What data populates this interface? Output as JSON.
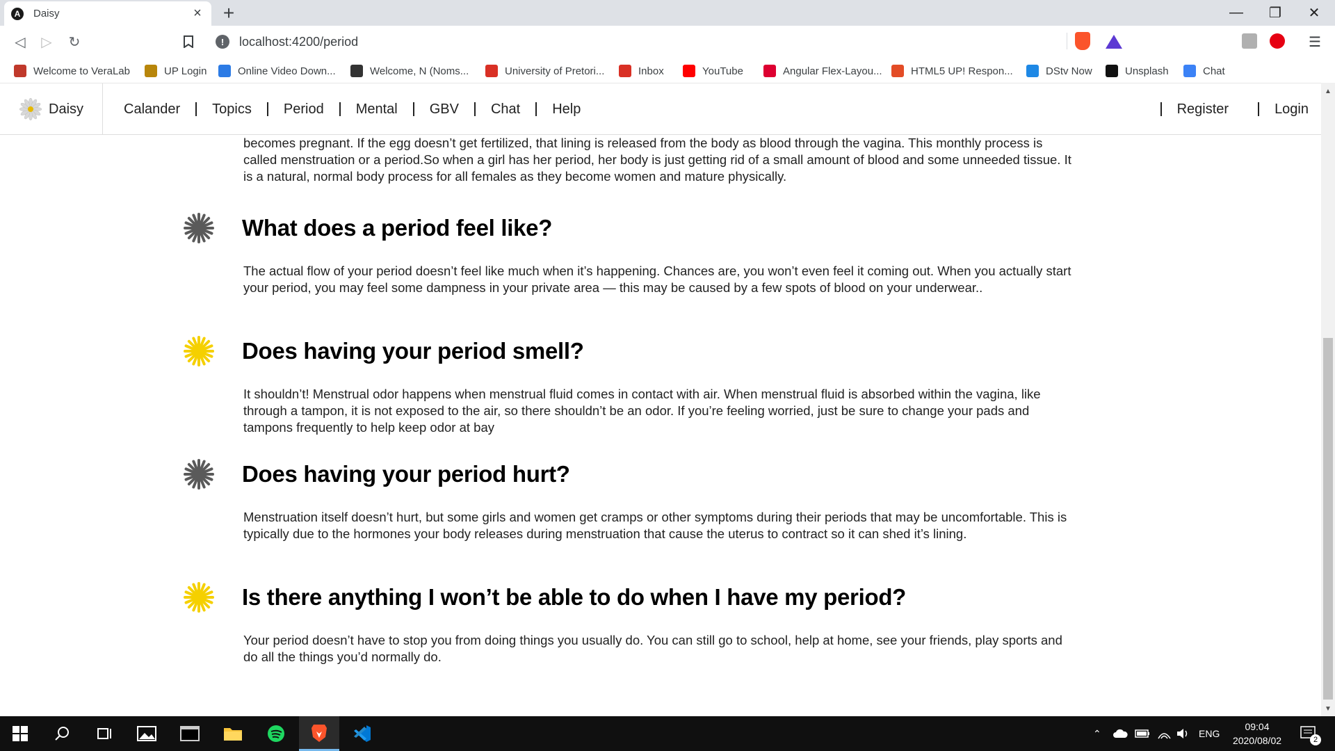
{
  "browser": {
    "tab_title": "Daisy",
    "tab_favicon": "A",
    "url": "localhost:4200/period",
    "bookmarks": [
      {
        "label": "Welcome to VeraLab",
        "icon": "veralab-icon",
        "color": "#c0392b"
      },
      {
        "label": "UP Login",
        "icon": "up-icon",
        "color": "#b8860b"
      },
      {
        "label": "Online Video Down...",
        "icon": "s-icon",
        "color": "#2c7be5"
      },
      {
        "label": "Welcome, N (Noms...",
        "icon": "bb-icon",
        "color": "#333333"
      },
      {
        "label": "University of Pretori...",
        "icon": "gmail-icon",
        "color": "#d93025"
      },
      {
        "label": "Inbox",
        "icon": "gmail-icon",
        "color": "#d93025"
      },
      {
        "label": "YouTube",
        "icon": "youtube-icon",
        "color": "#ff0000"
      },
      {
        "label": "Angular Flex-Layou...",
        "icon": "angular-icon",
        "color": "#dd0031"
      },
      {
        "label": "HTML5 UP! Respon...",
        "icon": "html5up-icon",
        "color": "#e34c26"
      },
      {
        "label": "DStv Now",
        "icon": "dstv-icon",
        "color": "#1e88e5"
      },
      {
        "label": "Unsplash",
        "icon": "unsplash-icon",
        "color": "#111111"
      },
      {
        "label": "Chat",
        "icon": "chat-icon",
        "color": "#3b82f6"
      }
    ]
  },
  "nav": {
    "brand": "Daisy",
    "links": [
      "Calander",
      "Topics",
      "Period",
      "Mental",
      "GBV",
      "Chat",
      "Help"
    ],
    "auth": [
      "Register",
      "Login"
    ]
  },
  "content": {
    "intro_partial": "becomes pregnant. If the egg doesn’t get fertilized, that lining is released from the body as blood through the vagina. This monthly process is called menstruation or a period.So when a girl has her period, her body is just getting rid of a small amount of blood and some unneeded tissue. It is a natural, normal body process for all females as they become women and mature physically.",
    "sections": [
      {
        "heading": "What does a period feel like?",
        "flower": "grey",
        "text": "The actual flow of your period doesn’t feel like much when it’s happening. Chances are, you won’t even feel it coming out. When you actually start your period, you may feel some dampness in your private area — this may be caused by a few spots of blood on your underwear.."
      },
      {
        "heading": "Does having your period smell?",
        "flower": "yellow",
        "text": "It shouldn’t! Menstrual odor happens when menstrual fluid comes in contact with air. When menstrual fluid is absorbed within the vagina, like through a tampon, it is not exposed to the air, so there shouldn’t be an odor. If you’re feeling worried, just be sure to change your pads and tampons frequently to help keep odor at bay"
      },
      {
        "heading": "Does having your period hurt?",
        "flower": "grey",
        "text": "Menstruation itself doesn’t hurt, but some girls and women get cramps or other symptoms during their periods that may be uncomfortable. This is typically due to the hormones your body releases during menstruation that cause the uterus to contract so it can shed it’s lining."
      },
      {
        "heading": "Is there anything I won’t be able to do when I have my period?",
        "flower": "yellow",
        "text": "Your period doesn’t have to stop you from doing things you usually do. You can still go to school, help at home, see your friends, play sports and do all the things you’d normally do."
      }
    ]
  },
  "colors": {
    "flower_grey": "#5a5a5a",
    "flower_yellow": "#f5d000",
    "taskbar": "#101010"
  },
  "taskbar": {
    "language": "ENG",
    "time": "09:04",
    "date": "2020/08/02",
    "notifications": "2"
  }
}
